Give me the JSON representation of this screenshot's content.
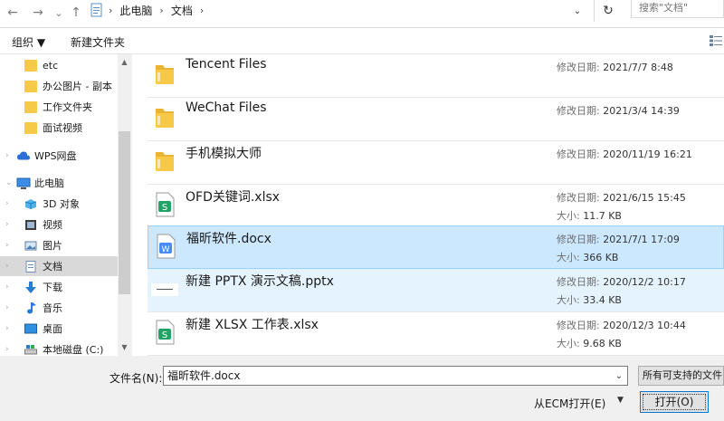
{
  "address": {
    "back": "←",
    "forward": "→",
    "recent": "⌄",
    "up": "↑",
    "breadcrumb": [
      "此电脑",
      "文档"
    ],
    "search_placeholder": "搜索\"文档\""
  },
  "toolbar": {
    "organize": "组织 ▼",
    "new_folder": "新建文件夹"
  },
  "sidebar": {
    "items": [
      {
        "label": "etc",
        "icon": "folder-icon"
      },
      {
        "label": "办公图片 - 副本",
        "icon": "folder-icon"
      },
      {
        "label": "工作文件夹",
        "icon": "folder-icon"
      },
      {
        "label": "面试视频",
        "icon": "folder-icon"
      },
      {
        "label": "WPS网盘",
        "icon": "cloud-icon"
      },
      {
        "label": "此电脑",
        "icon": "computer-icon"
      },
      {
        "label": "3D 对象",
        "icon": "cube-icon"
      },
      {
        "label": "视频",
        "icon": "video-icon"
      },
      {
        "label": "图片",
        "icon": "picture-icon"
      },
      {
        "label": "文档",
        "icon": "document-icon"
      },
      {
        "label": "下载",
        "icon": "download-icon"
      },
      {
        "label": "音乐",
        "icon": "music-icon"
      },
      {
        "label": "桌面",
        "icon": "desktop-icon"
      },
      {
        "label": "本地磁盘 (C:)",
        "icon": "drive-icon"
      }
    ]
  },
  "files": [
    {
      "name": "Tencent Files",
      "type": "folder",
      "modified_label": "修改日期:",
      "modified": "2021/7/7 8:48"
    },
    {
      "name": "WeChat Files",
      "type": "folder",
      "modified_label": "修改日期:",
      "modified": "2021/3/4 14:39"
    },
    {
      "name": "手机模拟大师",
      "type": "folder",
      "modified_label": "修改日期:",
      "modified": "2020/11/19 16:21"
    },
    {
      "name": "OFD关键词.xlsx",
      "type": "xlsx",
      "modified_label": "修改日期:",
      "modified": "2021/6/15 15:45",
      "size_label": "大小:",
      "size": "11.7 KB"
    },
    {
      "name": "福昕软件.docx",
      "type": "docx",
      "modified_label": "修改日期:",
      "modified": "2021/7/1 17:09",
      "size_label": "大小:",
      "size": "366 KB"
    },
    {
      "name": "新建 PPTX 演示文稿.pptx",
      "type": "pptx",
      "modified_label": "修改日期:",
      "modified": "2020/12/2 10:17",
      "size_label": "大小:",
      "size": "33.4 KB"
    },
    {
      "name": "新建 XLSX 工作表.xlsx",
      "type": "xlsx",
      "modified_label": "修改日期:",
      "modified": "2020/12/3 10:44",
      "size_label": "大小:",
      "size": "9.68 KB"
    }
  ],
  "bottom": {
    "filename_label": "文件名(N):",
    "filename_value": "福昕软件.docx",
    "filetype": "所有可支持的文件",
    "ecm_button": "从ECM打开(E)",
    "open_button": "打开(O)"
  },
  "colors": {
    "selection": "#cce8ff",
    "hover": "#e5f3ff",
    "folder": "#f7c948",
    "xlsx": "#21a366",
    "docx": "#4a8cf7"
  }
}
